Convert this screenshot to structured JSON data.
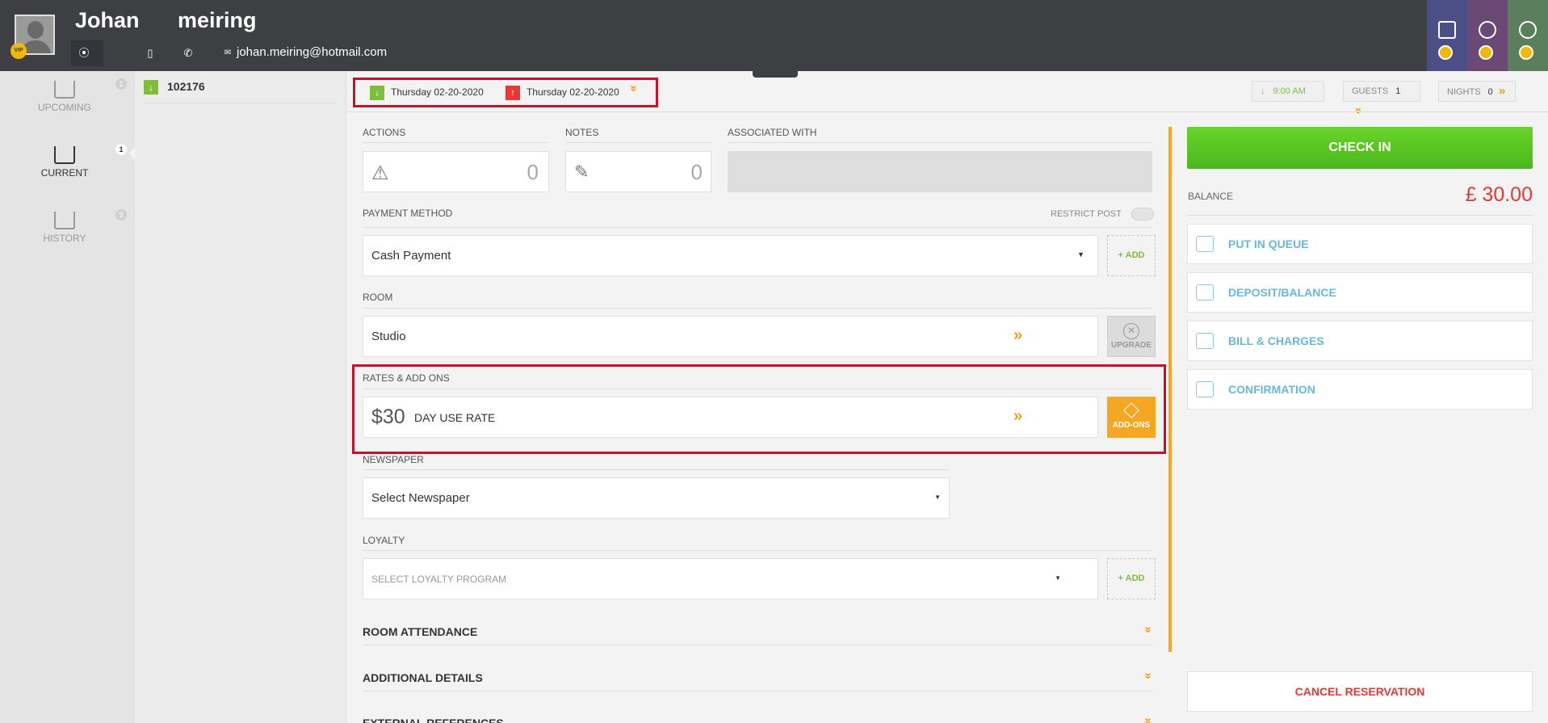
{
  "header": {
    "first_name": "Johan",
    "last_name": "meiring",
    "vip_badge": "VIP",
    "email": "johan.meiring@hotmail.com",
    "tiles": [
      "building-search",
      "globe-search",
      "circles-search"
    ]
  },
  "nav": {
    "items": [
      {
        "label": "UPCOMING",
        "count": "1"
      },
      {
        "label": "CURRENT",
        "count": "1"
      },
      {
        "label": "HISTORY",
        "count": "9"
      }
    ]
  },
  "reservation": {
    "number": "102176"
  },
  "topbar": {
    "arrival_date": "Thursday 02-20-2020",
    "departure_date": "Thursday 02-20-2020",
    "time": "9:00 AM",
    "guests_label": "GUESTS",
    "guests_value": "1",
    "nights_label": "NIGHTS",
    "nights_value": "0"
  },
  "main": {
    "actions_label": "ACTIONS",
    "actions_count": "0",
    "notes_label": "NOTES",
    "notes_count": "0",
    "associated_label": "ASSOCIATED WITH",
    "payment_label": "PAYMENT METHOD",
    "restrict_post_label": "RESTRICT POST",
    "payment_value": "Cash Payment",
    "add_label": "+ ADD",
    "room_label": "ROOM",
    "room_value": "Studio",
    "upgrade_label": "UPGRADE",
    "rates_label": "RATES & ADD ONS",
    "rate_amount": "$30",
    "rate_name": "DAY USE RATE",
    "addons_label": "ADD-ONS",
    "newspaper_label": "NEWSPAPER",
    "newspaper_value": "Select Newspaper",
    "loyalty_label": "LOYALTY",
    "loyalty_placeholder": "SELECT LOYALTY PROGRAM",
    "loyalty_add_label": "+ ADD",
    "room_attendance": "ROOM ATTENDANCE",
    "additional_details": "ADDITIONAL DETAILS",
    "external_references": "EXTERNAL REFERENCES"
  },
  "right": {
    "checkin_label": "CHECK IN",
    "balance_label": "BALANCE",
    "balance_value": "£ 30.00",
    "actions": [
      "PUT IN QUEUE",
      "DEPOSIT/BALANCE",
      "BILL & CHARGES",
      "CONFIRMATION"
    ],
    "cancel_label": "CANCEL RESERVATION"
  },
  "colors": {
    "header_bg": "#3e3f43",
    "accent_orange": "#f5a623",
    "checkin_green": "#5cc624",
    "link_blue": "#6ab7d9",
    "cancel_red": "#e53935",
    "highlight_red": "#c8102e"
  }
}
